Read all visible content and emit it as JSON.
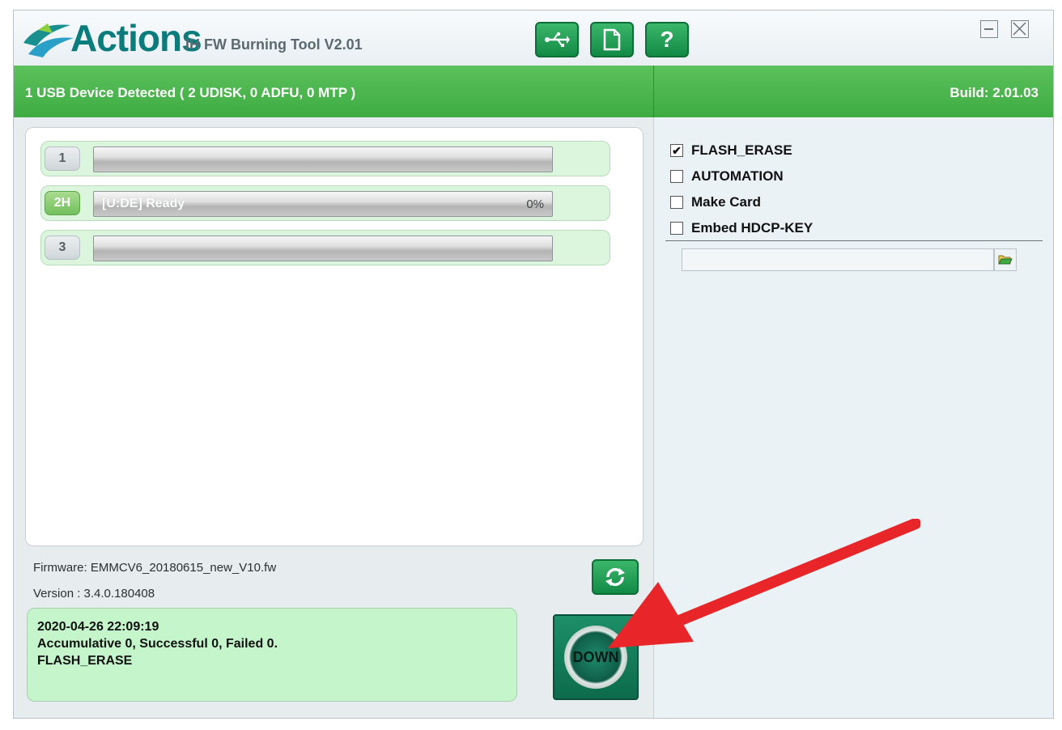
{
  "window": {
    "logo_text": "Actions",
    "title": "IH FW Burning Tool V2.01",
    "toolbar": {
      "usb_icon": "usb-icon",
      "file_icon": "file-icon",
      "help_label": "?"
    },
    "controls": {
      "minimize_icon": "minimize-icon",
      "close_icon": "close-icon"
    }
  },
  "status": {
    "detected": "1 USB Device Detected ( 2 UDISK, 0 ADFU, 0 MTP )",
    "build": "Build: 2.01.03"
  },
  "devices": [
    {
      "slot": "1",
      "status": "",
      "percent": "",
      "progress": 0,
      "active": false
    },
    {
      "slot": "2H",
      "status": "[U:DE] Ready",
      "percent": "0%",
      "progress": 0,
      "active": true
    },
    {
      "slot": "3",
      "status": "",
      "percent": "",
      "progress": 0,
      "active": false
    }
  ],
  "firmware": {
    "file": "Firmware: EMMCV6_20180615_new_V10.fw",
    "version": "Version : 3.4.0.180408"
  },
  "log": {
    "line1": "2020-04-26 22:09:19",
    "line2": "Accumulative 0, Successful 0, Failed 0.",
    "line3": "FLASH_ERASE"
  },
  "buttons": {
    "down": "DOWN",
    "refresh_icon": "refresh-icon"
  },
  "options": [
    {
      "label": "FLASH_ERASE",
      "checked": true
    },
    {
      "label": "AUTOMATION",
      "checked": false
    },
    {
      "label": "Make Card",
      "checked": false
    },
    {
      "label": "Embed HDCP-KEY",
      "checked": false
    }
  ],
  "hdcp_path": {
    "value": "",
    "browse_icon": "folder-open-icon"
  },
  "colors": {
    "accent_green": "#3eab43",
    "teal": "#0b7c7c",
    "arrow_red": "#e8262a",
    "log_bg": "#c5f5cb"
  }
}
